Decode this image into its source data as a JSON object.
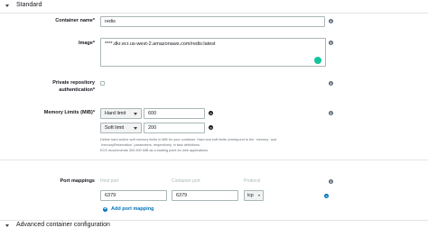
{
  "section": {
    "title": "Standard"
  },
  "container_name": {
    "label": "Container name*",
    "value": "redis"
  },
  "image": {
    "label": "Image*",
    "value": "****.dkr.ecr.us-west-2.amazonaws.com/redis:latest"
  },
  "private_repo": {
    "label_line1": "Private repository",
    "label_line2": "authentication*"
  },
  "memory": {
    "label": "Memory Limits (MiB)*",
    "hard_limit": {
      "select": "Hard limit",
      "value": "600"
    },
    "soft_limit": {
      "select": "Soft limit",
      "value": "200"
    },
    "help_line1": "Define hard and/or soft memory limits in MiB for your container. Hard and soft limits correspond to the `memory` and",
    "help_line2": "`memoryReservation` parameters, respectively, in task definitions.",
    "help_line3": "ECS recommends 300-500 MiB as a starting point for web applications."
  },
  "port_mappings": {
    "label": "Port mappings",
    "col_host": "Host port",
    "col_container": "Container port",
    "col_protocol": "Protocol",
    "host_port": "6379",
    "container_port": "6379",
    "protocol": "tcp",
    "add_link": "Add port mapping"
  },
  "next_section": {
    "title": "Advanced container configuration"
  },
  "colors": {
    "link": "#0073bb",
    "border": "#aab7b8",
    "info": "#5f6b7a",
    "grammarly": "#15c39a"
  }
}
